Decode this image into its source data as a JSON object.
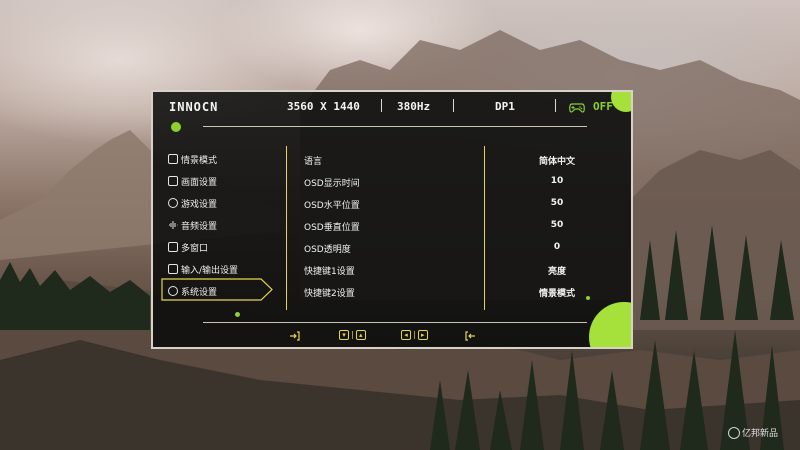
{
  "header": {
    "logo": "INNOCN",
    "resolution": "3560 X 1440",
    "refresh": "380Hz",
    "input": "DP1",
    "game_mode_status": "OFF"
  },
  "menu": {
    "items": [
      {
        "label": "情景模式",
        "icon": "scenario-icon"
      },
      {
        "label": "画面设置",
        "icon": "picture-icon"
      },
      {
        "label": "游戏设置",
        "icon": "gamepad-icon"
      },
      {
        "label": "音频设置",
        "icon": "audio-icon"
      },
      {
        "label": "多窗口",
        "icon": "window-icon"
      },
      {
        "label": "输入/输出设置",
        "icon": "io-icon"
      },
      {
        "label": "系统设置",
        "icon": "gear-icon"
      }
    ],
    "selected": "系统设置"
  },
  "settings": [
    {
      "label": "语言",
      "value": "简体中文"
    },
    {
      "label": "OSD显示时间",
      "value": "10"
    },
    {
      "label": "OSD水平位置",
      "value": "50"
    },
    {
      "label": "OSD垂直位置",
      "value": "50"
    },
    {
      "label": "OSD透明度",
      "value": "0"
    },
    {
      "label": "快捷键1设置",
      "value": "亮度"
    },
    {
      "label": "快捷键2设置",
      "value": "情景模式"
    }
  ],
  "footer": {
    "icons": [
      "enter-icon",
      "down-up-icon",
      "left-right-icon",
      "back-icon"
    ]
  },
  "watermark": {
    "text": "亿邦新品"
  },
  "colors": {
    "accent_yellow": "#e6d64a",
    "accent_green": "#8bd12f",
    "panel": "#080a0a",
    "border": "#d6d2c8"
  }
}
